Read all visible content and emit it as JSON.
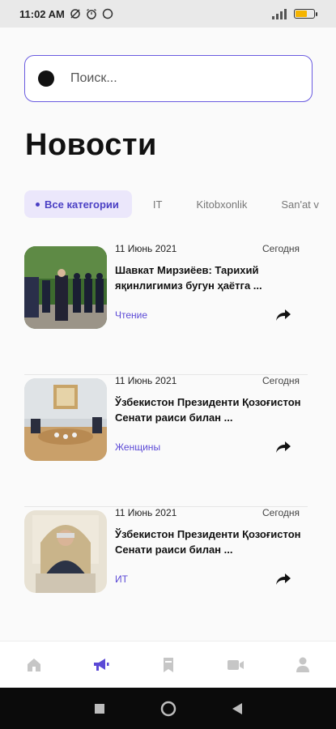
{
  "status_bar": {
    "time": "11:02 AM",
    "battery_level": 0.65,
    "battery_color": "#f5b400"
  },
  "search": {
    "placeholder": "Поиск..."
  },
  "page_title": "Новости",
  "tabs": [
    {
      "label": "Все категории",
      "active": true
    },
    {
      "label": "IT",
      "active": false
    },
    {
      "label": "Kitobxonlik",
      "active": false
    },
    {
      "label": "San'at v",
      "active": false
    }
  ],
  "news": [
    {
      "date": "11 Июнь 2021",
      "relative": "Сегодня",
      "headline": "Шавкат Мирзиёев: Тарихий яқинлигимиз бугун ҳаётга ...",
      "category": "Чтение"
    },
    {
      "date": "11 Июнь 2021",
      "relative": "Сегодня",
      "headline": "Ўзбекистон Президенти Қозоғистон Сенати раиси билан ...",
      "category": "Женщины"
    },
    {
      "date": "11 Июнь 2021",
      "relative": "Сегодня",
      "headline": "Ўзбекистон Президенти Қозоғистон Сенати раиси билан ...",
      "category": "ИТ"
    }
  ],
  "bottom_nav": [
    {
      "icon": "home-icon",
      "active": false
    },
    {
      "icon": "megaphone-icon",
      "active": true
    },
    {
      "icon": "bookmark-icon",
      "active": false
    },
    {
      "icon": "video-icon",
      "active": false
    },
    {
      "icon": "profile-icon",
      "active": false
    }
  ],
  "colors": {
    "accent": "#5b49d6",
    "tab_active_bg": "#ebe7fb",
    "nav_inactive": "#c6c6c6",
    "search_border": "#6a5be0"
  }
}
